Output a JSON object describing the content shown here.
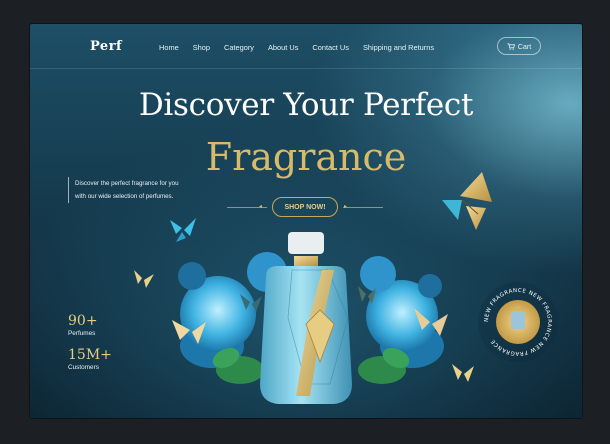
{
  "brand": {
    "logo": "Perf"
  },
  "nav": {
    "items": [
      "Home",
      "Shop",
      "Category",
      "About Us",
      "Contact Us",
      "Shipping and Returns"
    ],
    "cart_label": "Cart"
  },
  "hero": {
    "title_line1": "Discover Your Perfect",
    "title_line2": "Fragrance",
    "intro": "Discover the perfect fragrance for you with our wide selection of perfumes.",
    "cta_label": "SHOP NOW!"
  },
  "stats": [
    {
      "value": "90+",
      "label": "Perfumes"
    },
    {
      "value": "15M+",
      "label": "Customers"
    }
  ],
  "badge": {
    "ring_text": "NEW FRAGRANCE NEW FRAGRANCE NEW FRAGRANCE"
  },
  "colors": {
    "gold": "#d8bb6a",
    "teal_bg": "#153a4d",
    "bottle_blue": "#7fc9df"
  }
}
